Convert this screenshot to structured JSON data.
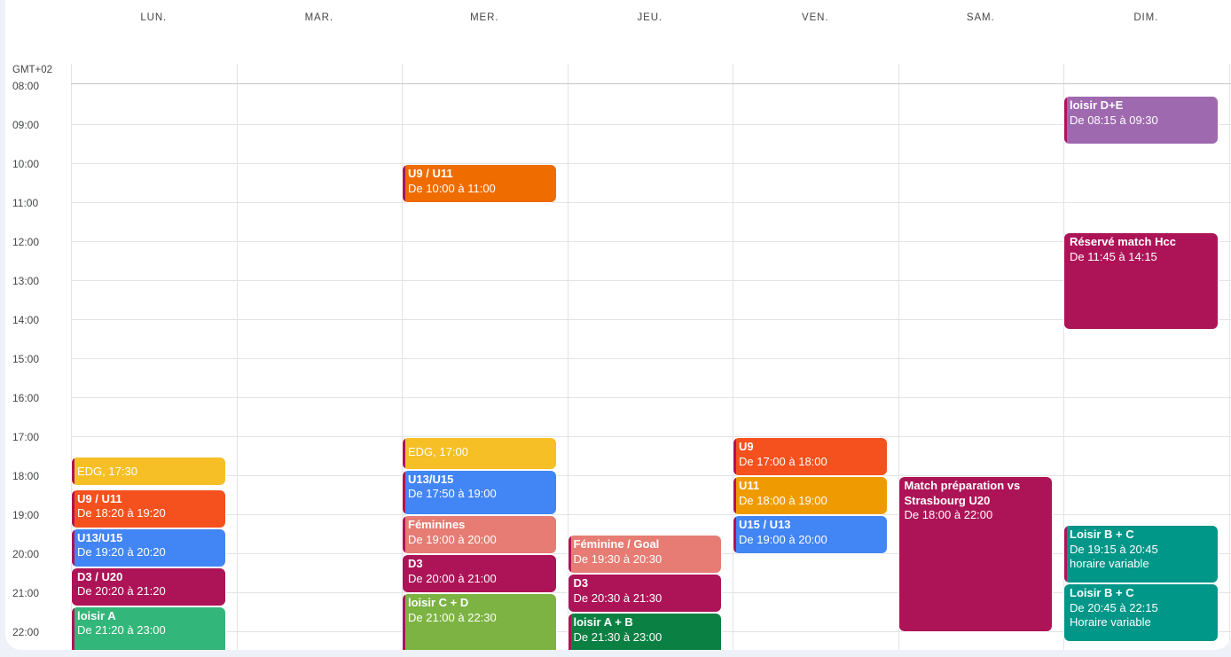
{
  "calendar": {
    "timezone": "GMT+02",
    "days": [
      "LUN.",
      "MAR.",
      "MER.",
      "JEU.",
      "VEN.",
      "SAM.",
      "DIM."
    ],
    "hours": [
      "08:00",
      "09:00",
      "10:00",
      "11:00",
      "12:00",
      "13:00",
      "14:00",
      "15:00",
      "16:00",
      "17:00",
      "18:00",
      "19:00",
      "20:00",
      "21:00",
      "22:00"
    ],
    "events": [
      {
        "day": 0,
        "start": "17:30",
        "end": "18:15",
        "title": "EDG, 17:30",
        "time": "",
        "color": "#f6bf26",
        "stripe": "#ad1457"
      },
      {
        "day": 0,
        "start": "18:20",
        "end": "19:20",
        "title": "U9 / U11",
        "time": "De 18:20 à 19:20",
        "color": "#f4511e",
        "stripe": "#ad1457"
      },
      {
        "day": 0,
        "start": "19:20",
        "end": "20:20",
        "title": "U13/U15",
        "time": "De 19:20 à 20:20",
        "color": "#4285f4",
        "stripe": "#ad1457"
      },
      {
        "day": 0,
        "start": "20:20",
        "end": "21:20",
        "title": "D3 / U20",
        "time": "De 20:20 à 21:20",
        "color": "#ad1457",
        "stripe": "#ad1457"
      },
      {
        "day": 0,
        "start": "21:20",
        "end": "23:00",
        "title": "loisir A",
        "time": "De 21:20 à 23:00",
        "color": "#33b679",
        "stripe": "#ad1457"
      },
      {
        "day": 2,
        "start": "10:00",
        "end": "11:00",
        "title": "U9 / U11",
        "time": "De 10:00 à 11:00",
        "color": "#ef6c00",
        "stripe": "#ad1457"
      },
      {
        "day": 2,
        "start": "17:00",
        "end": "17:50",
        "title": "EDG, 17:00",
        "time": "",
        "color": "#f6bf26",
        "stripe": "#ad1457"
      },
      {
        "day": 2,
        "start": "17:50",
        "end": "19:00",
        "title": "U13/U15",
        "time": "De 17:50 à 19:00",
        "color": "#4285f4",
        "stripe": "#ad1457"
      },
      {
        "day": 2,
        "start": "19:00",
        "end": "20:00",
        "title": "Féminines",
        "time": "De 19:00 à 20:00",
        "color": "#e67c73",
        "stripe": "#ad1457"
      },
      {
        "day": 2,
        "start": "20:00",
        "end": "21:00",
        "title": "D3",
        "time": "De 20:00 à 21:00",
        "color": "#ad1457",
        "stripe": "#ad1457"
      },
      {
        "day": 2,
        "start": "21:00",
        "end": "22:30",
        "title": "loisir C + D",
        "time": "De 21:00 à 22:30",
        "color": "#7cb342",
        "stripe": "#ad1457"
      },
      {
        "day": 3,
        "start": "19:30",
        "end": "20:30",
        "title": "Féminine / Goal",
        "time": "De 19:30 à 20:30",
        "color": "#e67c73",
        "stripe": "#ad1457"
      },
      {
        "day": 3,
        "start": "20:30",
        "end": "21:30",
        "title": "D3",
        "time": "De 20:30 à 21:30",
        "color": "#ad1457",
        "stripe": "#ad1457"
      },
      {
        "day": 3,
        "start": "21:30",
        "end": "23:00",
        "title": "loisir A + B",
        "time": "De 21:30 à 23:00",
        "color": "#0b8043",
        "stripe": "#ad1457"
      },
      {
        "day": 4,
        "start": "17:00",
        "end": "18:00",
        "title": "U9",
        "time": "De 17:00 à 18:00",
        "color": "#f4511e",
        "stripe": "#ad1457"
      },
      {
        "day": 4,
        "start": "18:00",
        "end": "19:00",
        "title": "U11",
        "time": "De 18:00 à 19:00",
        "color": "#ef9b00",
        "stripe": "#ad1457"
      },
      {
        "day": 4,
        "start": "19:00",
        "end": "20:00",
        "title": "U15 / U13",
        "time": "De 19:00 à 20:00",
        "color": "#4285f4",
        "stripe": "#ad1457"
      },
      {
        "day": 5,
        "start": "18:00",
        "end": "22:00",
        "title": "Match préparation vs Strasbourg U20",
        "time": "De 18:00 à 22:00",
        "color": "#ad1457",
        "stripe": "#ad1457"
      },
      {
        "day": 6,
        "start": "08:15",
        "end": "09:30",
        "title": "loisir D+E",
        "time": "De 08:15 à 09:30",
        "color": "#9e69af",
        "stripe": "#ad1457"
      },
      {
        "day": 6,
        "start": "11:45",
        "end": "14:15",
        "title": "Réservé match Hcc",
        "time": "De 11:45 à 14:15",
        "color": "#ad1457",
        "stripe": "#ad1457"
      },
      {
        "day": 6,
        "start": "19:15",
        "end": "20:45",
        "title": "Loisir B + C",
        "time": "De 19:15 à 20:45",
        "note": "horaire variable",
        "color": "#009688",
        "stripe": "#ad1457"
      },
      {
        "day": 6,
        "start": "20:45",
        "end": "22:15",
        "title": "Loisir B + C",
        "time": "De 20:45 à 22:15",
        "note": "Horaire variable",
        "color": "#009688",
        "stripe": "#009688"
      }
    ]
  }
}
